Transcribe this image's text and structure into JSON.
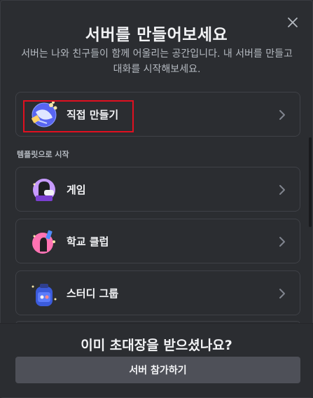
{
  "modal": {
    "title": "서버를 만들어보세요",
    "subtitle": "서버는 나와 친구들이 함께 어울리는 공간입니다. 내 서버를 만들고 대화를 시작해보세요.",
    "close_icon": "close-icon"
  },
  "create_own": {
    "label": "직접 만들기",
    "icon": "globe-create-icon"
  },
  "templates": {
    "section_label": "템플릿으로 시작",
    "items": [
      {
        "label": "게임",
        "icon": "gaming-icon"
      },
      {
        "label": "학교 클럽",
        "icon": "school-club-icon"
      },
      {
        "label": "스터디 그룹",
        "icon": "study-group-icon"
      }
    ]
  },
  "footer": {
    "title": "이미 초대장을 받으셨나요?",
    "join_label": "서버 참가하기"
  },
  "colors": {
    "background": "#2b2d31",
    "option_border": "#3f4147",
    "highlight": "#e01020",
    "join_button": "#4e5058"
  }
}
